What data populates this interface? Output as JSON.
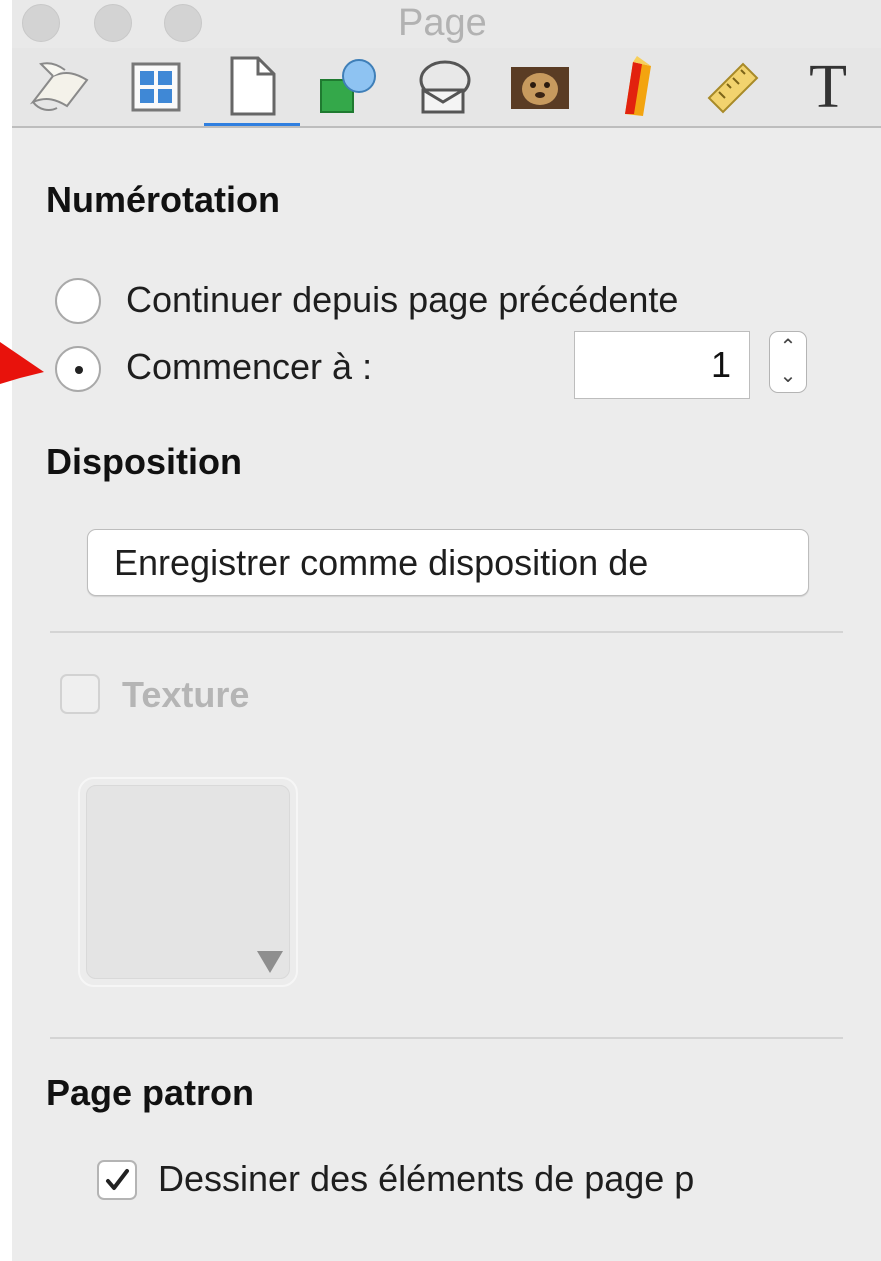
{
  "window": {
    "title": "Page"
  },
  "toolbar": {
    "tools": [
      {
        "icon": "document-scroll-icon"
      },
      {
        "icon": "layout-grid-icon"
      },
      {
        "icon": "page-icon",
        "active": true
      },
      {
        "icon": "shapes-icon"
      },
      {
        "icon": "speech-bubble-icon"
      },
      {
        "icon": "photo-icon"
      },
      {
        "icon": "color-pencil-icon"
      },
      {
        "icon": "ruler-icon"
      },
      {
        "icon": "text-icon",
        "glyph": "T"
      }
    ],
    "active_color": "#2f7fe0"
  },
  "numbering": {
    "title": "Numérotation",
    "option_continue": "Continuer depuis page précédente",
    "option_start": "Commencer à :",
    "selected": "start",
    "start_value": "1"
  },
  "layout": {
    "title": "Disposition",
    "button_label": "Enregistrer comme disposition de"
  },
  "texture": {
    "label": "Texture",
    "checked": false,
    "enabled": false
  },
  "master_page": {
    "title": "Page patron",
    "checkbox_label": "Dessiner des éléments de page p",
    "checked": true
  },
  "annotation": {
    "arrow_color": "#e8120c"
  }
}
